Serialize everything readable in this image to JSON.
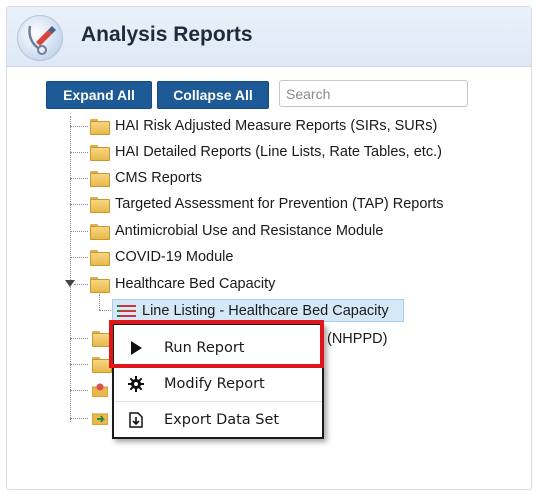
{
  "header": {
    "title": "Analysis Reports"
  },
  "toolbar": {
    "expand_label": "Expand All",
    "collapse_label": "Collapse All",
    "search_placeholder": "Search"
  },
  "tree": {
    "nodes": [
      {
        "label": "HAI Risk Adjusted Measure Reports (SIRs, SURs)"
      },
      {
        "label": "HAI Detailed Reports (Line Lists, Rate Tables, etc.)"
      },
      {
        "label": "CMS Reports"
      },
      {
        "label": "Targeted Assessment for Prevention (TAP) Reports"
      },
      {
        "label": "Antimicrobial Use and Resistance Module"
      },
      {
        "label": "COVID-19 Module"
      },
      {
        "label": "Healthcare Bed Capacity"
      }
    ],
    "selected_child": {
      "label": "Line Listing - Healthcare Bed Capacity"
    },
    "partial_label": "(NHPPD)"
  },
  "context_menu": {
    "items": [
      {
        "label": "Run Report",
        "icon": "play-icon"
      },
      {
        "label": "Modify Report",
        "icon": "gear-icon"
      },
      {
        "label": "Export Data Set",
        "icon": "export-icon"
      }
    ]
  },
  "colors": {
    "button_bg": "#1d5a96",
    "highlight_border": "#e0161b",
    "selected_bg": "#d4e8f8"
  }
}
